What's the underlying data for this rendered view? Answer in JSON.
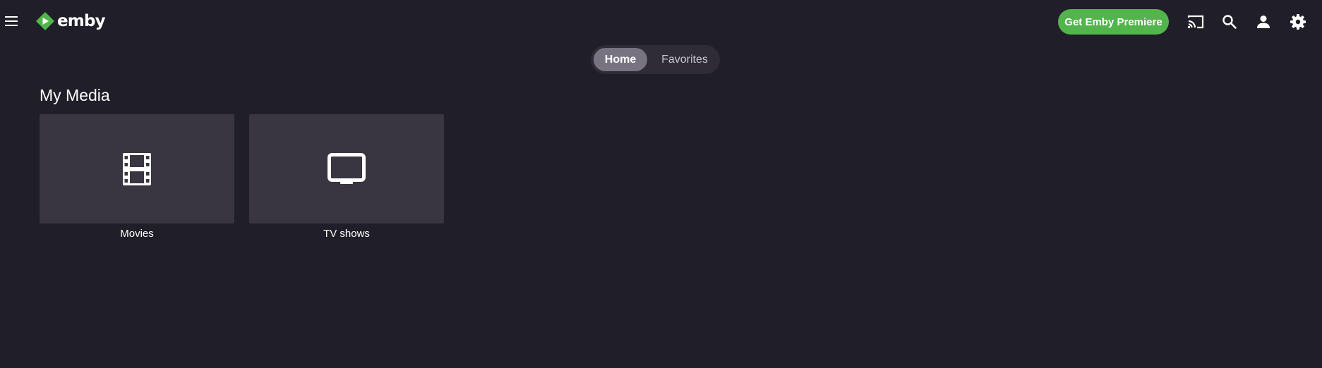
{
  "header": {
    "menu_icon": "hamburger-menu-icon",
    "logo_text": "emby",
    "premiere_label": "Get Emby Premiere",
    "icons": [
      "cast-icon",
      "search-icon",
      "user-icon",
      "settings-gear-icon"
    ]
  },
  "tabs": [
    {
      "label": "Home",
      "selected": true
    },
    {
      "label": "Favorites",
      "selected": false
    }
  ],
  "section": {
    "title": "My Media",
    "items": [
      {
        "label": "Movies",
        "icon": "film-icon"
      },
      {
        "label": "TV shows",
        "icon": "tv-icon"
      }
    ]
  },
  "colors": {
    "background": "#201e28",
    "accent_green": "#52b54b",
    "card_bg": "#393541",
    "tab_selected": "#777380"
  }
}
